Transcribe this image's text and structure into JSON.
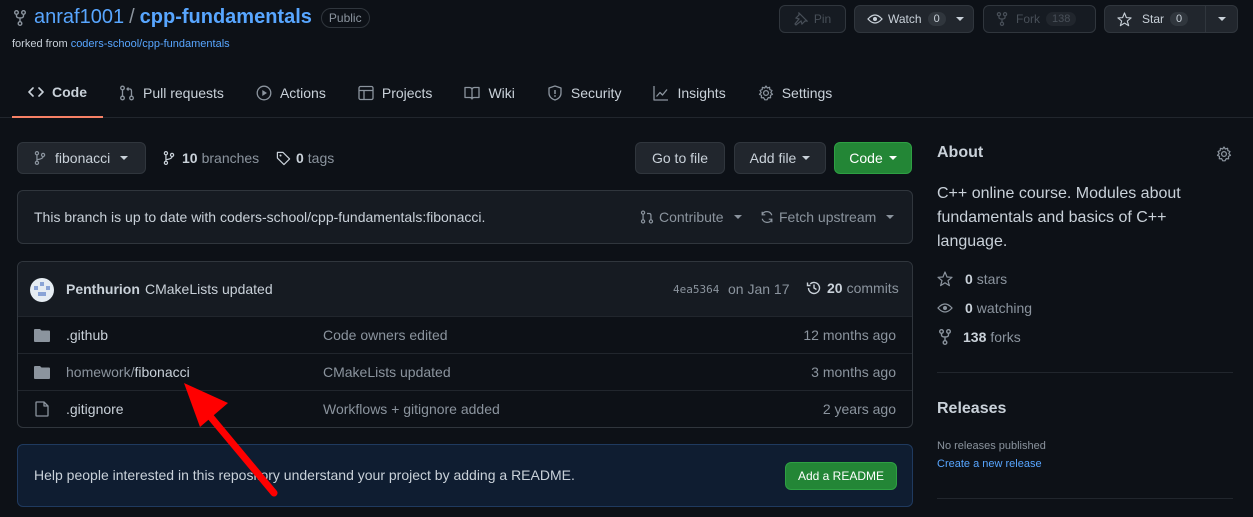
{
  "repo": {
    "owner": "anraf1001",
    "slash": "/",
    "name": "cpp-fundamentals",
    "visibility": "Public",
    "forked_from_prefix": "forked from ",
    "forked_from": "coders-school/cpp-fundamentals"
  },
  "header_buttons": {
    "pin": "Pin",
    "watch": "Watch",
    "watch_count": "0",
    "fork": "Fork",
    "fork_count": "138",
    "star": "Star",
    "star_count": "0"
  },
  "tabs": [
    {
      "label": "Code",
      "icon": "code-icon"
    },
    {
      "label": "Pull requests",
      "icon": "pull-request-icon"
    },
    {
      "label": "Actions",
      "icon": "play-icon"
    },
    {
      "label": "Projects",
      "icon": "table-icon"
    },
    {
      "label": "Wiki",
      "icon": "book-icon"
    },
    {
      "label": "Security",
      "icon": "shield-icon"
    },
    {
      "label": "Insights",
      "icon": "graph-icon"
    },
    {
      "label": "Settings",
      "icon": "gear-icon"
    }
  ],
  "toolbar": {
    "branch": "fibonacci",
    "branches_count": "10",
    "branches_label": "branches",
    "tags_count": "0",
    "tags_label": "tags",
    "go_to_file": "Go to file",
    "add_file": "Add file",
    "code": "Code"
  },
  "branch_status": {
    "text": "This branch is up to date with coders-school/cpp-fundamentals:fibonacci.",
    "contribute": "Contribute",
    "fetch_upstream": "Fetch upstream"
  },
  "commit": {
    "author": "Penthurion",
    "message": "CMakeLists updated",
    "hash": "4ea5364",
    "date": "on Jan 17",
    "commits_count": "20",
    "commits_label": "commits"
  },
  "files": [
    {
      "type": "folder",
      "name_prefix": "",
      "name": ".github",
      "message": "Code owners edited",
      "age": "12 months ago"
    },
    {
      "type": "folder",
      "name_prefix": "homework/",
      "name": "fibonacci",
      "message": "CMakeLists updated",
      "age": "3 months ago"
    },
    {
      "type": "file",
      "name_prefix": "",
      "name": ".gitignore",
      "message": "Workflows + gitignore added",
      "age": "2 years ago"
    }
  ],
  "readme_banner": {
    "text": "Help people interested in this repository understand your project by adding a README.",
    "button": "Add a README"
  },
  "about": {
    "title": "About",
    "description": "C++ online course. Modules about fundamentals and basics of C++ language.",
    "stars_count": "0",
    "stars_label": "stars",
    "watching_count": "0",
    "watching_label": "watching",
    "forks_count": "138",
    "forks_label": "forks"
  },
  "releases": {
    "title": "Releases",
    "none": "No releases published",
    "create": "Create a new release"
  },
  "colors": {
    "background": "#0d1117",
    "link": "#58a6ff",
    "green_button": "#238636",
    "active_tab_underline": "#f78166",
    "annotation_arrow": "#ff0000"
  }
}
